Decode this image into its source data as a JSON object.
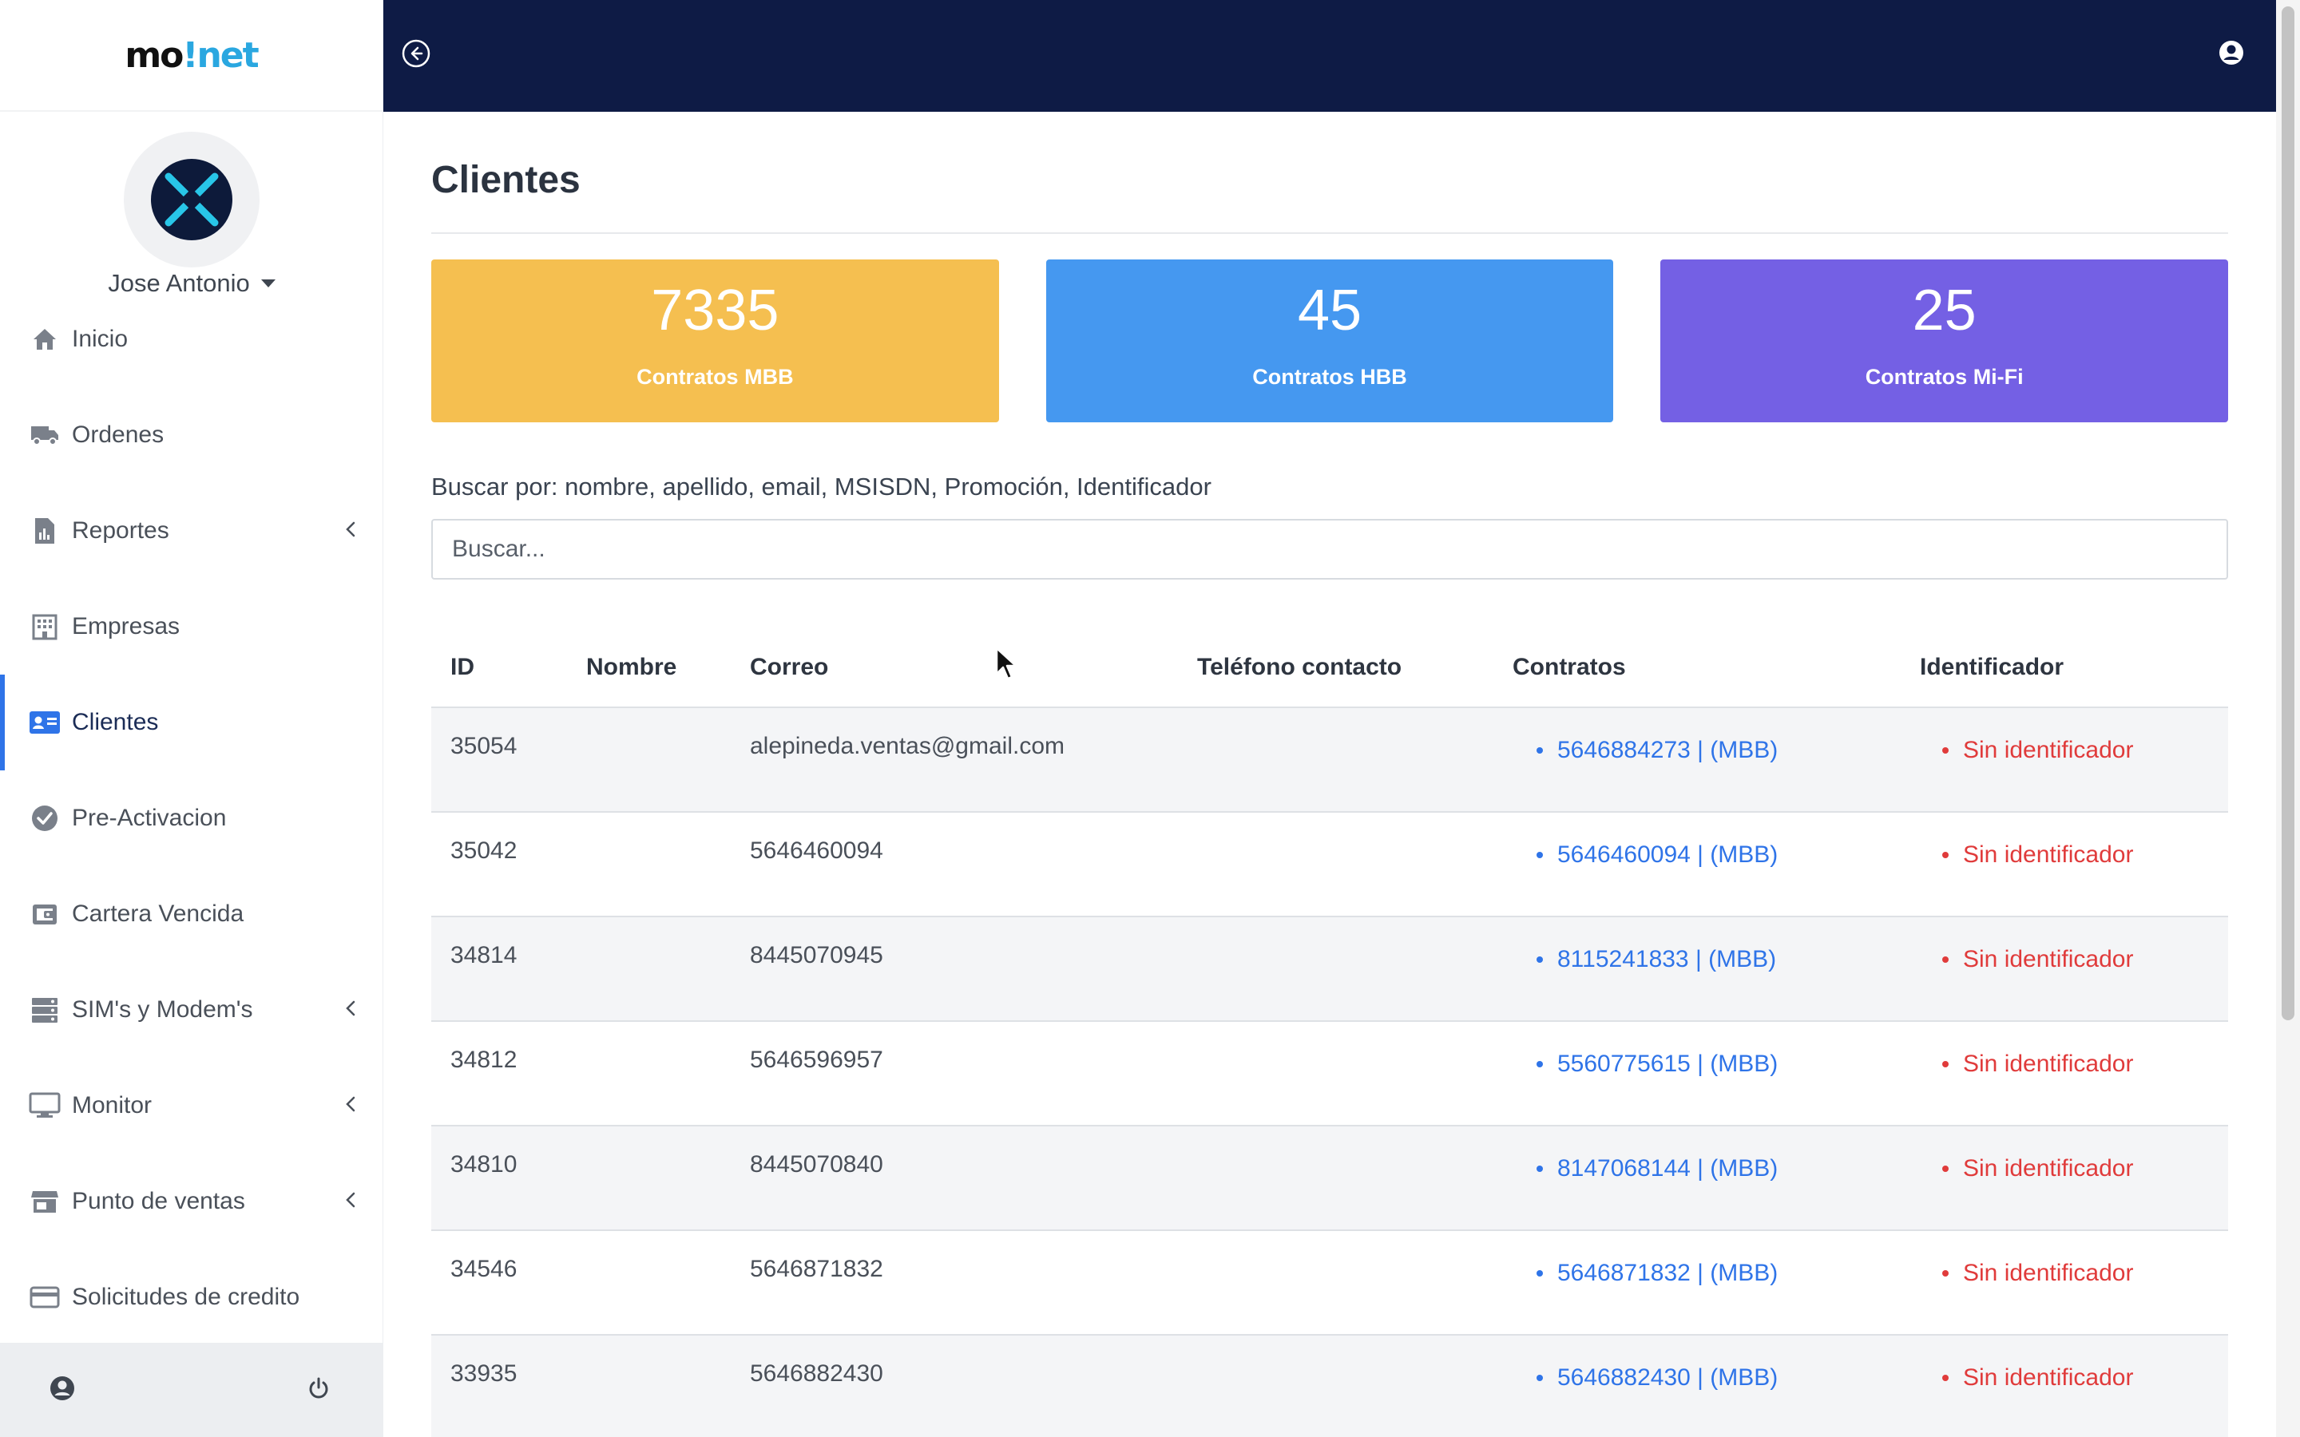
{
  "app": {
    "logo_prefix": "mo",
    "logo_suffix": "!net"
  },
  "profile": {
    "name": "Jose Antonio"
  },
  "nav": [
    {
      "label": "Inicio",
      "icon": "home-icon",
      "has_chevron": false
    },
    {
      "label": "Ordenes",
      "icon": "truck-icon",
      "has_chevron": false
    },
    {
      "label": "Reportes",
      "icon": "report-icon",
      "has_chevron": true
    },
    {
      "label": "Empresas",
      "icon": "building-icon",
      "has_chevron": false
    },
    {
      "label": "Clientes",
      "icon": "id-card-icon",
      "has_chevron": false,
      "active": true
    },
    {
      "label": "Pre-Activacion",
      "icon": "check-circle-icon",
      "has_chevron": false
    },
    {
      "label": "Cartera Vencida",
      "icon": "wallet-icon",
      "has_chevron": false
    },
    {
      "label": "SIM's y Modem's",
      "icon": "server-icon",
      "has_chevron": true
    },
    {
      "label": "Monitor",
      "icon": "monitor-icon",
      "has_chevron": true
    },
    {
      "label": "Punto de ventas",
      "icon": "store-icon",
      "has_chevron": true
    },
    {
      "label": "Solicitudes de credito",
      "icon": "credit-card-icon",
      "has_chevron": false
    }
  ],
  "main": {
    "title": "Clientes",
    "cards": [
      {
        "value": "7335",
        "label": "Contratos MBB",
        "color": "#f5bf50"
      },
      {
        "value": "45",
        "label": "Contratos HBB",
        "color": "#4598f0"
      },
      {
        "value": "25",
        "label": "Contratos Mi-Fi",
        "color": "#7460e4"
      }
    ],
    "search": {
      "label": "Buscar por: nombre, apellido, email, MSISDN, Promoción, Identificador",
      "placeholder": "Buscar..."
    },
    "table": {
      "headers": [
        "ID",
        "Nombre",
        "Correo",
        "Teléfono contacto",
        "Contratos",
        "Identificador"
      ],
      "rows": [
        {
          "id": "35054",
          "nombre": "",
          "correo": "alepineda.ventas@gmail.com",
          "telefono": "",
          "contrato": "5646884273 | (MBB)",
          "identificador": "Sin identificador"
        },
        {
          "id": "35042",
          "nombre": "",
          "correo": "5646460094",
          "telefono": "",
          "contrato": "5646460094 | (MBB)",
          "identificador": "Sin identificador"
        },
        {
          "id": "34814",
          "nombre": "",
          "correo": "8445070945",
          "telefono": "",
          "contrato": "8115241833 | (MBB)",
          "identificador": "Sin identificador"
        },
        {
          "id": "34812",
          "nombre": "",
          "correo": "5646596957",
          "telefono": "",
          "contrato": "5560775615 | (MBB)",
          "identificador": "Sin identificador"
        },
        {
          "id": "34810",
          "nombre": "",
          "correo": "8445070840",
          "telefono": "",
          "contrato": "8147068144 | (MBB)",
          "identificador": "Sin identificador"
        },
        {
          "id": "34546",
          "nombre": "",
          "correo": "5646871832",
          "telefono": "",
          "contrato": "5646871832 | (MBB)",
          "identificador": "Sin identificador"
        },
        {
          "id": "33935",
          "nombre": "",
          "correo": "5646882430",
          "telefono": "",
          "contrato": "5646882430 | (MBB)",
          "identificador": "Sin identificador"
        }
      ]
    }
  },
  "colors": {
    "topbar": "#0e1b45",
    "link": "#2f74e8",
    "danger": "#e03b3b",
    "active_indicator": "#2f74e8"
  }
}
